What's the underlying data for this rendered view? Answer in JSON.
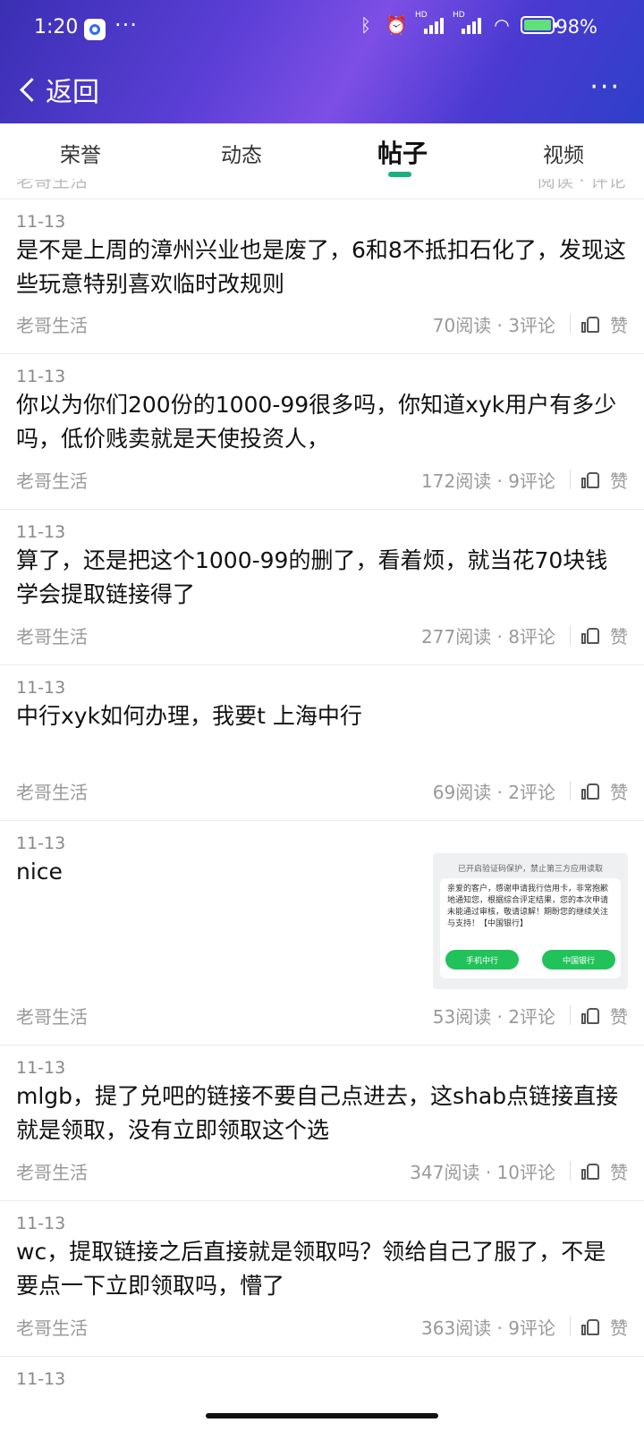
{
  "status_bar": {
    "time": "1:20",
    "dots": "···",
    "battery_pct": "98%",
    "hd1": "HD",
    "hd2": "HD"
  },
  "nav": {
    "back_label": "返回",
    "more": "···"
  },
  "tabs": [
    {
      "label": "荣誉"
    },
    {
      "label": "动态"
    },
    {
      "label": "帖子",
      "active": true
    },
    {
      "label": "视频"
    }
  ],
  "peek": {
    "author": "老哥生活",
    "stats": "阅读 · 评论"
  },
  "posts": [
    {
      "date": "11-13",
      "text": "是不是上周的漳州兴业也是废了，6和8不抵扣石化了，发现这些玩意特别喜欢临时改规则",
      "author": "老哥生活",
      "stats": "70阅读 · 3评论",
      "like": "赞"
    },
    {
      "date": "11-13",
      "text": "你以为你们200份的1000-99很多吗，你知道xyk用户有多少吗，低价贱卖就是天使投资人，",
      "author": "老哥生活",
      "stats": "172阅读 · 9评论",
      "like": "赞"
    },
    {
      "date": "11-13",
      "text": "算了，还是把这个1000-99的删了，看着烦，就当花70块钱学会提取链接得了",
      "author": "老哥生活",
      "stats": "277阅读 · 8评论",
      "like": "赞"
    },
    {
      "date": "11-13",
      "text": "中行xyk如何办理，我要t 上海中行",
      "author": "老哥生活",
      "stats": "69阅读 · 2评论",
      "like": "赞"
    },
    {
      "date": "11-13",
      "text": "nice",
      "author": "老哥生活",
      "stats": "53阅读 · 2评论",
      "like": "赞",
      "image": {
        "hint": "已开启验证码保护，禁止第三方应用读取",
        "message": "亲爱的客户，感谢申请我行信用卡，非常抱歉地通知您，根据综合评定结果，您的本次申请未能通过审核，敬请谅解！期盼您的继续关注与支持！【中国银行】",
        "btn1": "手机中行",
        "btn2": "中国银行"
      }
    },
    {
      "date": "11-13",
      "text": "mlgb，提了兑吧的链接不要自己点进去，这shab点链接直接就是领取，没有立即领取这个选",
      "author": "老哥生活",
      "stats": "347阅读 · 10评论",
      "like": "赞"
    },
    {
      "date": "11-13",
      "text": "wc，提取链接之后直接就是领取吗？领给自己了服了，不是要点一下立即领取吗，懵了",
      "author": "老哥生活",
      "stats": "363阅读 · 9评论",
      "like": "赞"
    },
    {
      "date": "11-13"
    }
  ]
}
